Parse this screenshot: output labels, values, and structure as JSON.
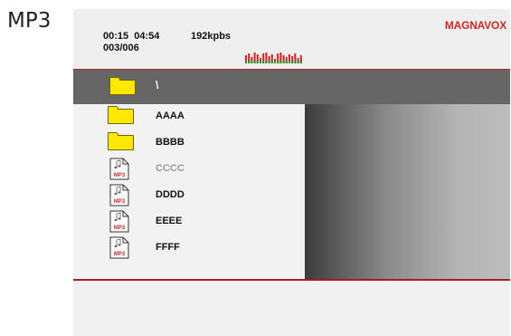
{
  "mode_label": "MP3",
  "status": {
    "elapsed": "00:15",
    "total": "04:54",
    "bitrate": "192kpbs",
    "track": "003/006",
    "equalizer_bars": 20
  },
  "brand": "MAGNAVOX",
  "current_folder": {
    "label": "\\",
    "icon": "folder-icon"
  },
  "items": [
    {
      "label": "AAAA",
      "type": "folder",
      "icon": "folder-icon"
    },
    {
      "label": "BBBB",
      "type": "folder",
      "icon": "folder-icon"
    },
    {
      "label": "CCCC",
      "type": "mp3",
      "icon": "mp3-file-icon",
      "dimmed": true
    },
    {
      "label": "DDDD",
      "type": "mp3",
      "icon": "mp3-file-icon"
    },
    {
      "label": "EEEE",
      "type": "mp3",
      "icon": "mp3-file-icon"
    },
    {
      "label": "FFFF",
      "type": "mp3",
      "icon": "mp3-file-icon"
    }
  ],
  "file_icon_text": "MP3",
  "colors": {
    "brand": "#c8282a",
    "folder": "#ffe800",
    "rule": "#b32025",
    "current_row": "#666666",
    "equalizer_red": "#cc2222",
    "equalizer_green": "#2a8a2a"
  }
}
